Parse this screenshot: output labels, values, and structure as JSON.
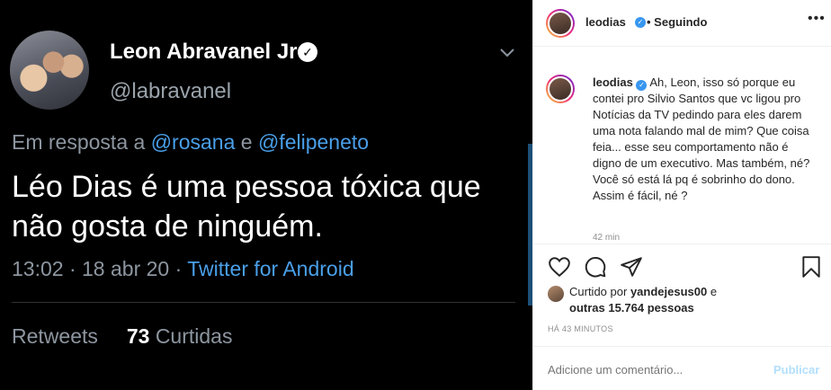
{
  "tweet": {
    "name": "Leon Abravanel Jr",
    "handle": "@labravanel",
    "reply_prefix": "Em resposta a",
    "reply_mention_1": "@rosana",
    "reply_and": "e",
    "reply_mention_2": "@felipeneto",
    "text": "Léo Dias é uma pessoa tóxica que não gosta de ninguém.",
    "time": "13:02",
    "date": "18 abr 20",
    "source": "Twitter for Android",
    "retweets_label": "Retweets",
    "likes_count": "73",
    "likes_label": "Curtidas"
  },
  "instagram": {
    "header_user": "leodias",
    "header_follow": "Seguindo",
    "caption_user": "leodias",
    "caption_text": "Ah, Leon, isso só porque eu contei pro Silvio Santos que vc ligou pro Notícias da TV pedindo para eles darem uma nota falando mal de mim? Que coisa feia... esse seu comportamento não é digno de um executivo. Mas também, né? Você só está lá pq é sobrinho do dono. Assim é fácil, né ?",
    "caption_time": "42 min",
    "liked_prefix": "Curtido por",
    "liked_user": "yandejesus00",
    "liked_and": "e",
    "liked_others": "outras 15.764 pessoas",
    "posted_ago": "HÁ 43 MINUTOS",
    "comment_placeholder": "Adicione um comentário...",
    "publish_label": "Publicar",
    "icons": [
      "heart-icon",
      "comment-icon",
      "share-icon",
      "bookmark-icon",
      "more-icon",
      "verified-icon",
      "chevron-down-icon"
    ]
  },
  "colors": {
    "twitter_bg": "#000000",
    "twitter_link": "#4a9fe8",
    "instagram_verified": "#3897f0",
    "publish_disabled": "#b2dffc"
  }
}
